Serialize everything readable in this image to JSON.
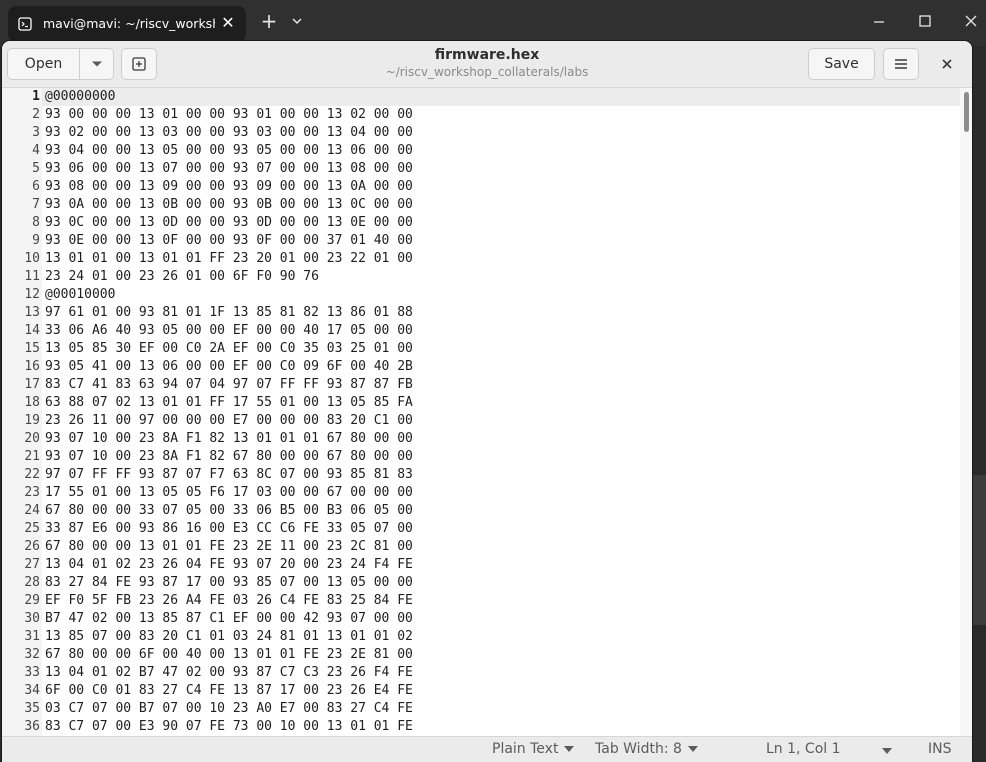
{
  "terminal": {
    "tab_title": "mavi@mavi: ~/riscv_workshop",
    "close_glyph": "✕",
    "new_tab_glyph": "+"
  },
  "gedit": {
    "open_label": "Open",
    "save_label": "Save",
    "title": "firmware.hex",
    "subtitle": "~/riscv_workshop_collaterals/labs",
    "lines": [
      {
        "n": "1",
        "t": "@00000000"
      },
      {
        "n": "2",
        "t": "93 00 00 00 13 01 00 00 93 01 00 00 13 02 00 00"
      },
      {
        "n": "3",
        "t": "93 02 00 00 13 03 00 00 93 03 00 00 13 04 00 00"
      },
      {
        "n": "4",
        "t": "93 04 00 00 13 05 00 00 93 05 00 00 13 06 00 00"
      },
      {
        "n": "5",
        "t": "93 06 00 00 13 07 00 00 93 07 00 00 13 08 00 00"
      },
      {
        "n": "6",
        "t": "93 08 00 00 13 09 00 00 93 09 00 00 13 0A 00 00"
      },
      {
        "n": "7",
        "t": "93 0A 00 00 13 0B 00 00 93 0B 00 00 13 0C 00 00"
      },
      {
        "n": "8",
        "t": "93 0C 00 00 13 0D 00 00 93 0D 00 00 13 0E 00 00"
      },
      {
        "n": "9",
        "t": "93 0E 00 00 13 0F 00 00 93 0F 00 00 37 01 40 00"
      },
      {
        "n": "10",
        "t": "13 01 01 00 13 01 01 FF 23 20 01 00 23 22 01 00"
      },
      {
        "n": "11",
        "t": "23 24 01 00 23 26 01 00 6F F0 90 76"
      },
      {
        "n": "12",
        "t": "@00010000"
      },
      {
        "n": "13",
        "t": "97 61 01 00 93 81 01 1F 13 85 81 82 13 86 01 88"
      },
      {
        "n": "14",
        "t": "33 06 A6 40 93 05 00 00 EF 00 00 40 17 05 00 00"
      },
      {
        "n": "15",
        "t": "13 05 85 30 EF 00 C0 2A EF 00 C0 35 03 25 01 00"
      },
      {
        "n": "16",
        "t": "93 05 41 00 13 06 00 00 EF 00 C0 09 6F 00 40 2B"
      },
      {
        "n": "17",
        "t": "83 C7 41 83 63 94 07 04 97 07 FF FF 93 87 87 FB"
      },
      {
        "n": "18",
        "t": "63 88 07 02 13 01 01 FF 17 55 01 00 13 05 85 FA"
      },
      {
        "n": "19",
        "t": "23 26 11 00 97 00 00 00 E7 00 00 00 83 20 C1 00"
      },
      {
        "n": "20",
        "t": "93 07 10 00 23 8A F1 82 13 01 01 01 67 80 00 00"
      },
      {
        "n": "21",
        "t": "93 07 10 00 23 8A F1 82 67 80 00 00 67 80 00 00"
      },
      {
        "n": "22",
        "t": "97 07 FF FF 93 87 07 F7 63 8C 07 00 93 85 81 83"
      },
      {
        "n": "23",
        "t": "17 55 01 00 13 05 05 F6 17 03 00 00 67 00 00 00"
      },
      {
        "n": "24",
        "t": "67 80 00 00 33 07 05 00 33 06 B5 00 B3 06 05 00"
      },
      {
        "n": "25",
        "t": "33 87 E6 00 93 86 16 00 E3 CC C6 FE 33 05 07 00"
      },
      {
        "n": "26",
        "t": "67 80 00 00 13 01 01 FE 23 2E 11 00 23 2C 81 00"
      },
      {
        "n": "27",
        "t": "13 04 01 02 23 26 04 FE 93 07 20 00 23 24 F4 FE"
      },
      {
        "n": "28",
        "t": "83 27 84 FE 93 87 17 00 93 85 07 00 13 05 00 00"
      },
      {
        "n": "29",
        "t": "EF F0 5F FB 23 26 A4 FE 03 26 C4 FE 83 25 84 FE"
      },
      {
        "n": "30",
        "t": "B7 47 02 00 13 85 87 C1 EF 00 00 42 93 07 00 00"
      },
      {
        "n": "31",
        "t": "13 85 07 00 83 20 C1 01 03 24 81 01 13 01 01 02"
      },
      {
        "n": "32",
        "t": "67 80 00 00 6F 00 40 00 13 01 01 FE 23 2E 81 00"
      },
      {
        "n": "33",
        "t": "13 04 01 02 B7 47 02 00 93 87 C7 C3 23 26 F4 FE"
      },
      {
        "n": "34",
        "t": "6F 00 C0 01 83 27 C4 FE 13 87 17 00 23 26 E4 FE"
      },
      {
        "n": "35",
        "t": "03 C7 07 00 B7 07 00 10 23 A0 E7 00 83 27 C4 FE"
      },
      {
        "n": "36",
        "t": "83 C7 07 00 E3 90 07 FE 73 00 10 00 13 01 01 FE"
      }
    ],
    "status": {
      "language": "Plain Text",
      "tab_width": "Tab Width: 8",
      "position": "Ln 1, Col 1",
      "mode": "INS"
    }
  }
}
